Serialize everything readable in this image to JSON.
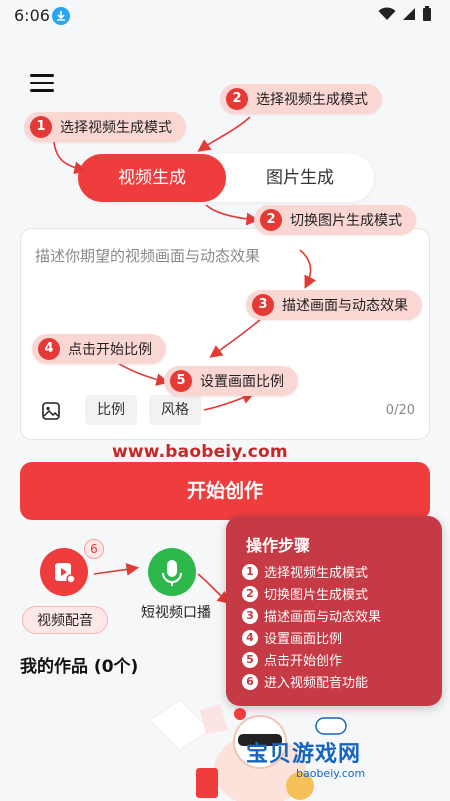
{
  "status_bar": {
    "time": "6:06"
  },
  "mode_tabs": {
    "video": "视频生成",
    "image": "图片生成"
  },
  "prompt": {
    "placeholder": "描述你期望的视频画面与动态效果",
    "ratio_chip": "比例",
    "style_chip": "风格",
    "counter": "0/20"
  },
  "watermark": "www.baobeiy.com",
  "start_button": "开始创作",
  "tools": {
    "dub_label": "视频配音",
    "dub_badge": "6",
    "live_label": "短视频口播"
  },
  "works_title": "我的作品 (0个)",
  "callouts": [
    {
      "num": "1",
      "text": "选择视频生成模式"
    },
    {
      "num": "2",
      "text": "选择视频生成模式"
    },
    {
      "num": "2",
      "text": "切换图片生成模式"
    },
    {
      "num": "3",
      "text": "描述画面与动态效果"
    },
    {
      "num": "4",
      "text": "点击开始比例"
    },
    {
      "num": "5",
      "text": "设置画面比例"
    }
  ],
  "steps_panel": {
    "title": "操作步骤",
    "steps": [
      {
        "num": "1",
        "text": "选择视频生成模式"
      },
      {
        "num": "2",
        "text": "切换图片生成模式"
      },
      {
        "num": "3",
        "text": "描述画面与动态效果"
      },
      {
        "num": "4",
        "text": "设置画面比例"
      },
      {
        "num": "5",
        "text": "点击开始创作"
      },
      {
        "num": "6",
        "text": "进入视频配音功能"
      }
    ]
  },
  "brand": {
    "name": "宝贝游戏网",
    "url": "baobeiy.com"
  },
  "colors": {
    "accent_red": "#ef3d3d",
    "green": "#2eb84c",
    "panel": "#c53a44",
    "callout_bg": "#fbd7d4"
  }
}
